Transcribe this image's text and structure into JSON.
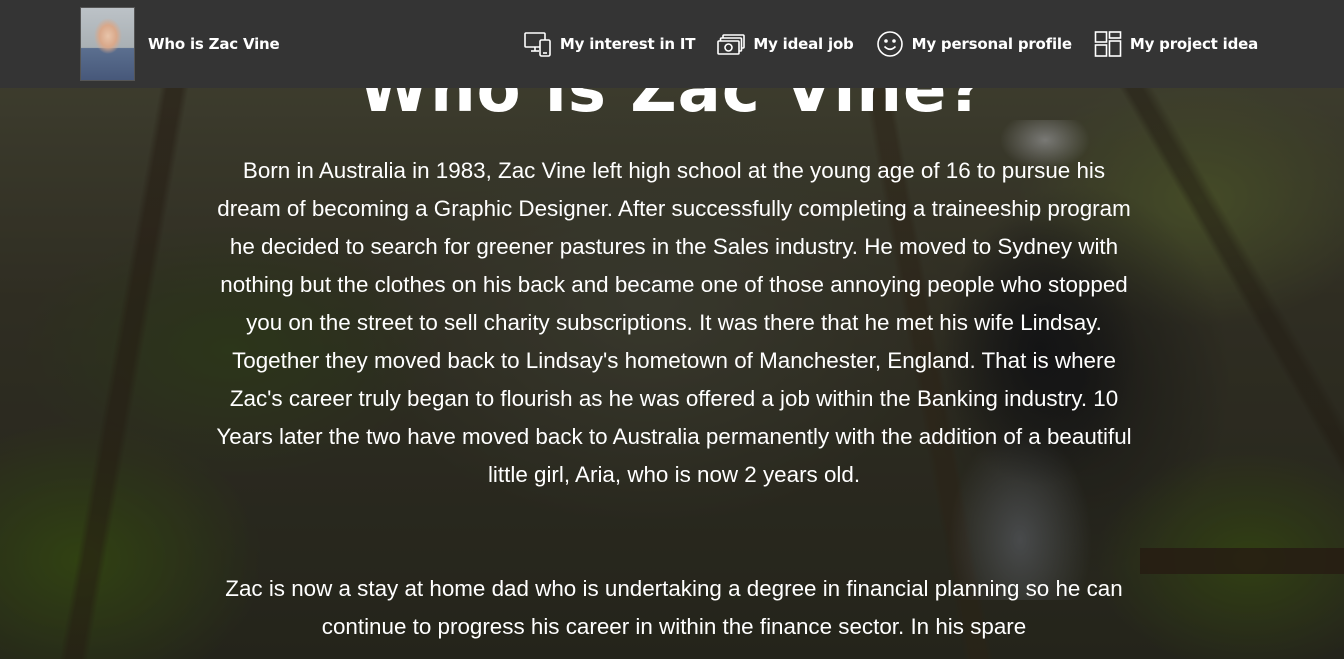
{
  "brand": {
    "name": "Who is Zac Vine"
  },
  "nav": {
    "items": [
      {
        "label": "My interest in IT",
        "icon": "devices-icon"
      },
      {
        "label": "My ideal job",
        "icon": "money-icon"
      },
      {
        "label": "My personal profile",
        "icon": "smiley-icon"
      },
      {
        "label": "My project idea",
        "icon": "layout-icon"
      }
    ]
  },
  "main": {
    "title": "Who is Zac Vine?",
    "paragraphs": [
      "Born in Australia in 1983, Zac Vine left high school at the young age of 16 to pursue his dream of becoming a Graphic Designer. After successfully completing a traineeship program he decided to search for greener pastures in the Sales industry. He moved to Sydney with nothing but the clothes on his back and became one of those annoying people who stopped you on the street to sell charity subscriptions. It was there that he met his wife Lindsay. Together they moved back to Lindsay's hometown of Manchester, England. That is where Zac's career truly began to flourish as he was offered a job within the Banking industry. 10 Years later the two have moved back to Australia permanently with the addition of a beautiful little girl, Aria, who is now 2 years old.",
      "Zac is now a stay at home dad who is undertaking a degree in financial planning so he can continue to progress his career in within the finance sector. In his spare"
    ]
  },
  "colors": {
    "navbar_bg": "#343434",
    "text": "#ffffff"
  }
}
